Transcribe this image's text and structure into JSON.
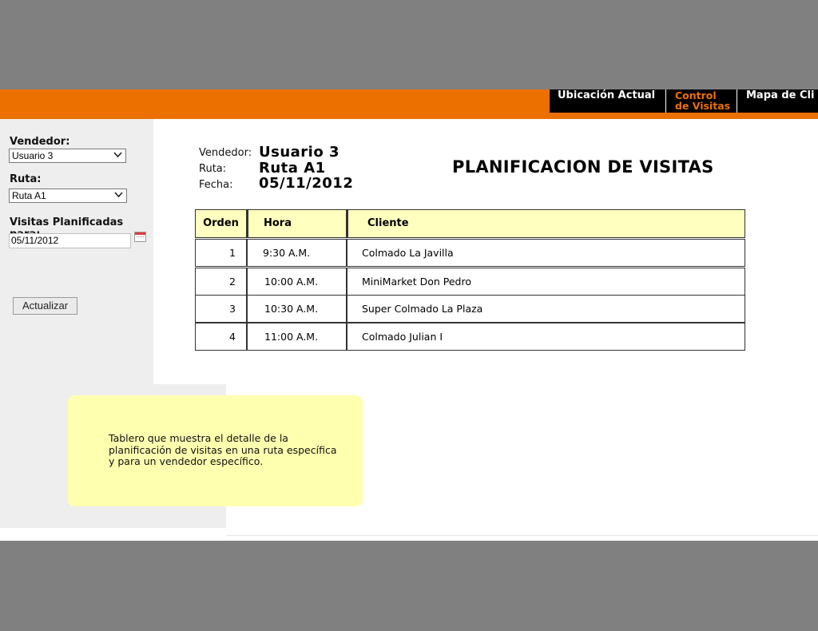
{
  "nav": {
    "items": [
      {
        "label": "Ubicación Actual"
      },
      {
        "label_line1": "Control",
        "label_line2": "de Visitas"
      },
      {
        "label": "Mapa de Cli"
      }
    ],
    "accent_color": "#ec7000"
  },
  "sidebar": {
    "vendedor_label": "Vendedor:",
    "vendedor_value": "Usuario 3",
    "ruta_label": "Ruta:",
    "ruta_value": "Ruta A1",
    "visitas_label": "Visitas Planificadas para:",
    "fecha_value": "05/11/2012",
    "update_button": "Actualizar"
  },
  "header": {
    "vendedor_label": "Vendedor:",
    "vendedor_value": "Usuario 3",
    "ruta_label": "Ruta:",
    "ruta_value": "Ruta A1",
    "fecha_label": "Fecha:",
    "fecha_value": "05/11/2012",
    "title": "PLANIFICACION DE VISITAS"
  },
  "table": {
    "columns": [
      "Orden",
      "Hora",
      "Cliente"
    ],
    "rows": [
      {
        "orden": "1",
        "hora": "9:30 A.M.",
        "cliente": "Colmado La Javilla"
      },
      {
        "orden": "2",
        "hora": "10:00 A.M.",
        "cliente": "MiniMarket Don Pedro"
      },
      {
        "orden": "3",
        "hora": "10:30 A.M.",
        "cliente": "Super Colmado La Plaza"
      },
      {
        "orden": "4",
        "hora": "11:00 A.M.",
        "cliente": "Colmado Julian I"
      }
    ]
  },
  "note": {
    "text": "Tablero que muestra el detalle de la planificación de visitas en una ruta específica y para un vendedor específico."
  }
}
